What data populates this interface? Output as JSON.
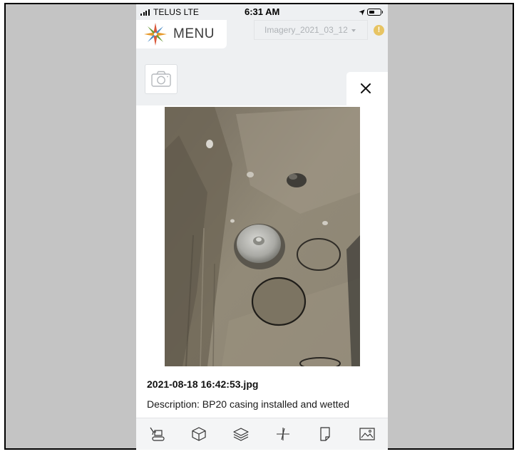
{
  "status_bar": {
    "carrier": "TELUS  LTE",
    "time": "6:31 AM"
  },
  "header": {
    "menu_label": "MENU",
    "imagery_selected": "Imagery_2021_03_12",
    "alert_symbol": "!"
  },
  "colors": {
    "accent_alert": "#e7c463",
    "panel_background": "#ffffff",
    "app_background": "#eef0f2"
  },
  "icons": {
    "camera": "camera-icon",
    "close": "close-icon",
    "logo": "compass-star-logo",
    "toolbar": [
      "excavator-icon",
      "cube-icon",
      "layers-icon",
      "measure-icon",
      "document-icon",
      "image-icon"
    ]
  },
  "photo_viewer": {
    "file_name": "2021-08-18 16:42:53.jpg",
    "description": "Description: BP20 casing installed and wetted"
  }
}
